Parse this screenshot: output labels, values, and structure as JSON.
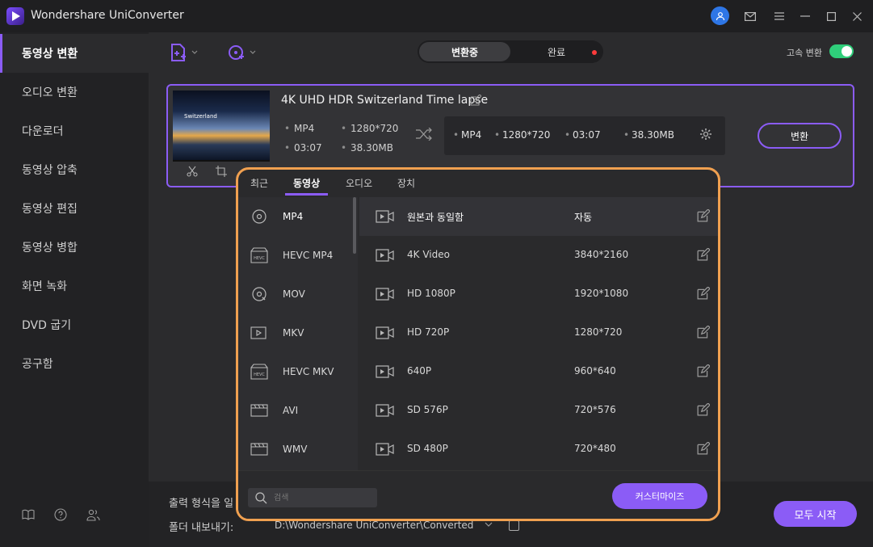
{
  "app": {
    "title": "Wondershare UniConverter"
  },
  "sidebar": {
    "items": [
      {
        "label": "동영상 변환",
        "active": true
      },
      {
        "label": "오디오 변환"
      },
      {
        "label": "다운로더"
      },
      {
        "label": "동영상 압축"
      },
      {
        "label": "동영상 편집"
      },
      {
        "label": "동영상 병합"
      },
      {
        "label": "화면 녹화"
      },
      {
        "label": "DVD 굽기"
      },
      {
        "label": "공구함"
      }
    ]
  },
  "toolbar": {
    "tabs": {
      "converting": "변환중",
      "done": "완료"
    },
    "speed_label": "고속 변환",
    "accent": "#8b5cf6",
    "toggle_color": "#2fce7a"
  },
  "file": {
    "title": "4K UHD HDR Switzerland Time lapse",
    "thumb_text": "Switzerland",
    "src": {
      "format": "MP4",
      "resolution": "1280*720",
      "duration": "03:07",
      "size": "38.30MB"
    },
    "out": {
      "format": "MP4",
      "resolution": "1280*720",
      "duration": "03:07",
      "size": "38.30MB"
    },
    "convert_label": "변환"
  },
  "bottom": {
    "output_label": "출력 형식을 일",
    "folder_label": "폴더 내보내기:",
    "path": "D:\\Wondershare UniConverter\\Converted",
    "start_all": "모두 시작"
  },
  "popup": {
    "tabs": [
      "최근",
      "동영상",
      "오디오",
      "장치"
    ],
    "formats": [
      "MP4",
      "HEVC MP4",
      "MOV",
      "MKV",
      "HEVC MKV",
      "AVI",
      "WMV"
    ],
    "resolutions": [
      {
        "name": "원본과 동일함",
        "value": "자동"
      },
      {
        "name": "4K Video",
        "value": "3840*2160"
      },
      {
        "name": "HD 1080P",
        "value": "1920*1080"
      },
      {
        "name": "HD 720P",
        "value": "1280*720"
      },
      {
        "name": "640P",
        "value": "960*640"
      },
      {
        "name": "SD 576P",
        "value": "720*576"
      },
      {
        "name": "SD 480P",
        "value": "720*480"
      }
    ],
    "search_placeholder": "검색",
    "customize": "커스터마이즈",
    "border_color": "#f0a050"
  }
}
